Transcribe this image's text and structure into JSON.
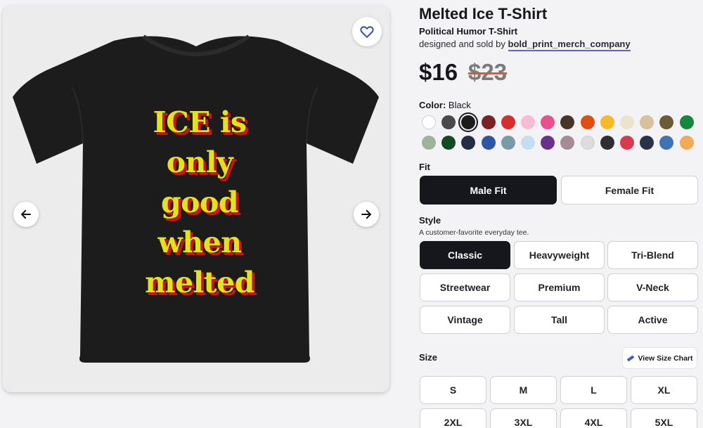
{
  "product": {
    "title": "Melted Ice T-Shirt",
    "subtitle": "Political Humor T-Shirt",
    "byline_prefix": "designed and sold by",
    "seller": "bold_print_merch_company",
    "price": "$16",
    "original_price": "$23"
  },
  "gallery": {
    "design_lines": [
      "ICE is",
      "only",
      "good",
      "when",
      "melted"
    ],
    "favorite_icon": "heart-icon",
    "prev_icon": "arrow-left-icon",
    "next_icon": "arrow-right-icon",
    "shirt_color": "#1c1c1c"
  },
  "color": {
    "label": "Color:",
    "selected": "Black",
    "swatches": [
      "#ffffff",
      "#4a4a4a",
      "#1c1c1c",
      "#7a2325",
      "#d62d2d",
      "#f7bcd0",
      "#ea4f8e",
      "#4a3426",
      "#e04e14",
      "#f6b928",
      "#ece3cf",
      "#d9bf9b",
      "#6b5b36",
      "#14883f",
      "#9cb59a",
      "#124a22",
      "#242d44",
      "#2d57a6",
      "#7c99a8",
      "#c4def0",
      "#6b2f8c",
      "#a68a94",
      "#dcdcdc",
      "#2e2e33",
      "#d93a52",
      "#283249",
      "#3e73b6",
      "#f2a95a"
    ],
    "selected_index": 2
  },
  "fit": {
    "label": "Fit",
    "options": [
      "Male Fit",
      "Female Fit"
    ],
    "selected_index": 0
  },
  "style": {
    "label": "Style",
    "description": "A customer-favorite everyday tee.",
    "options": [
      "Classic",
      "Heavyweight",
      "Tri-Blend",
      "Streetwear",
      "Premium",
      "V-Neck",
      "Vintage",
      "Tall",
      "Active"
    ],
    "selected_index": 0
  },
  "size": {
    "label": "Size",
    "chart_label": "View Size Chart",
    "chart_icon": "ruler-icon",
    "options": [
      "S",
      "M",
      "L",
      "XL",
      "2XL",
      "3XL",
      "4XL",
      "5XL"
    ]
  }
}
